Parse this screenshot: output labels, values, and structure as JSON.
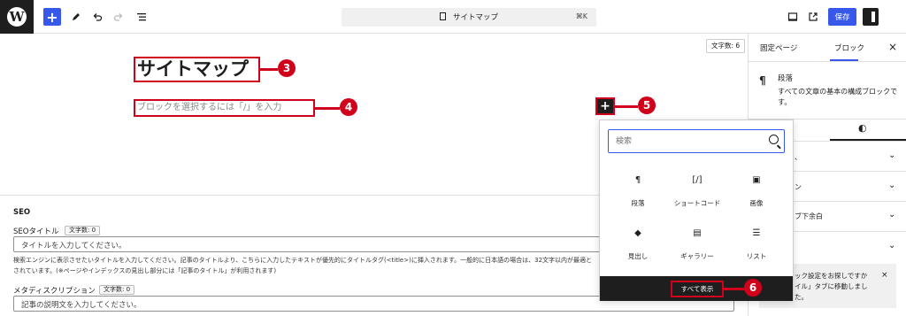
{
  "topbar": {
    "logo_letter": "W",
    "add_icon": "plus-icon",
    "tools_icon": "pencil-icon",
    "undo_icon": "undo-icon",
    "redo_icon": "redo-icon",
    "list_view_icon": "list-view-icon",
    "document_title": "サイトマップ",
    "shortcut": "⌘K",
    "view_icon": "desktop-icon",
    "preview_icon": "external-link-icon",
    "save_label": "保存",
    "settings_icon": "sidebar-toggle-icon"
  },
  "editor": {
    "word_count": "文字数: 6",
    "title": "サイトマップ",
    "paragraph_placeholder": "ブロックを選択するには「/」を入力",
    "inserter_symbol": "+"
  },
  "callouts": [
    "3",
    "4",
    "5",
    "6"
  ],
  "inserter_popover": {
    "search_placeholder": "検索",
    "blocks": [
      {
        "icon": "¶",
        "label": "段落"
      },
      {
        "icon": "[/]",
        "label": "ショートコード"
      },
      {
        "icon": "▣",
        "label": "画像"
      },
      {
        "icon": "◆",
        "label": "見出し"
      },
      {
        "icon": "▤",
        "label": "ギャラリー"
      },
      {
        "icon": "☰",
        "label": "リスト"
      }
    ],
    "show_all_label": "すべて表示"
  },
  "sidebar": {
    "tab_page": "固定ページ",
    "tab_block": "ブロック",
    "close": "×",
    "block_icon": "¶",
    "block_name": "段落",
    "block_description": "すべての文章の基本の構成ブロックです。",
    "style_icon": "◐",
    "panel_fragment_1": "、",
    "panel_fragment_2": "ン",
    "panel_fragment_3": "ブ下余白",
    "notice_text": "ック設定をお探しですか\nイル」タブに移動しまし\nた。",
    "notice_close": "×"
  },
  "meta": {
    "section_title": "SEO",
    "seo_title_label": "SEOタイトル",
    "seo_title_count": "文字数: 0",
    "seo_title_placeholder": "タイトルを入力してください。",
    "seo_help": "検索エンジンに表示させたいタイトルを入力してください。記事のタイトルより、こちらに入力したテキストが優先的にタイトルタグ(<title>)に挿入されます。一般的に日本語の場合は、32文字以内が最適とされています。(※ページやインデックスの見出し部分には「記事のタイトル」が利用されます)",
    "meta_desc_label": "メタディスクリプション",
    "meta_desc_count": "文字数: 0",
    "meta_desc_placeholder": "記事の説明文を入力してください。"
  },
  "colors": {
    "accent": "#3858e9",
    "annotation_red": "#d0021b",
    "dark": "#1e1e1e"
  }
}
